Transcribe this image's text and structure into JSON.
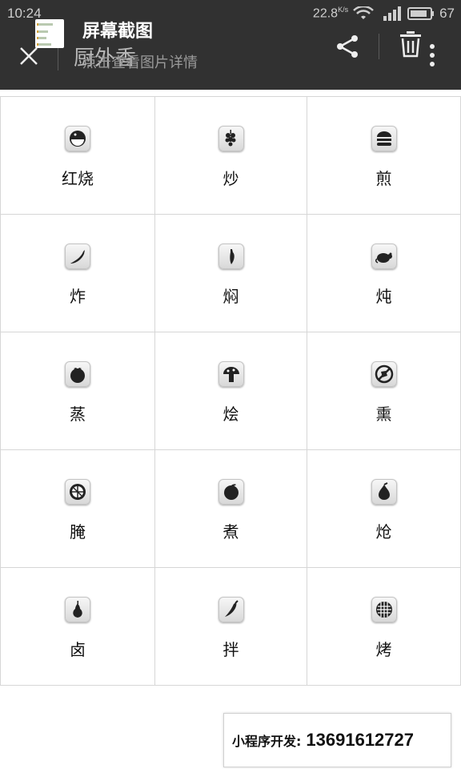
{
  "status_bar": {
    "time": "10:24",
    "net_speed": "22.8",
    "net_unit": "K/s",
    "battery": "67"
  },
  "header": {
    "background_title": "厨外香",
    "notification_title": "屏幕截图",
    "notification_subtitle": "点击查看图片详情"
  },
  "grid": {
    "items": [
      {
        "label": "红烧",
        "icon": "coconut-icon"
      },
      {
        "label": "炒",
        "icon": "grapes-icon"
      },
      {
        "label": "煎",
        "icon": "burger-icon"
      },
      {
        "label": "炸",
        "icon": "chili-icon"
      },
      {
        "label": "焖",
        "icon": "pepper-icon"
      },
      {
        "label": "炖",
        "icon": "mouse-icon"
      },
      {
        "label": "蒸",
        "icon": "tomato-icon"
      },
      {
        "label": "烩",
        "icon": "mushroom-icon"
      },
      {
        "label": "熏",
        "icon": "no-food-icon"
      },
      {
        "label": "腌",
        "icon": "orange-slice-icon"
      },
      {
        "label": "煮",
        "icon": "plum-icon"
      },
      {
        "label": "炝",
        "icon": "fig-icon"
      },
      {
        "label": "卤",
        "icon": "pear-icon"
      },
      {
        "label": "拌",
        "icon": "hot-pepper-icon"
      },
      {
        "label": "烤",
        "icon": "pie-icon"
      }
    ]
  },
  "footer": {
    "contact_label": "小程序开发:",
    "contact_phone": "13691612727"
  }
}
